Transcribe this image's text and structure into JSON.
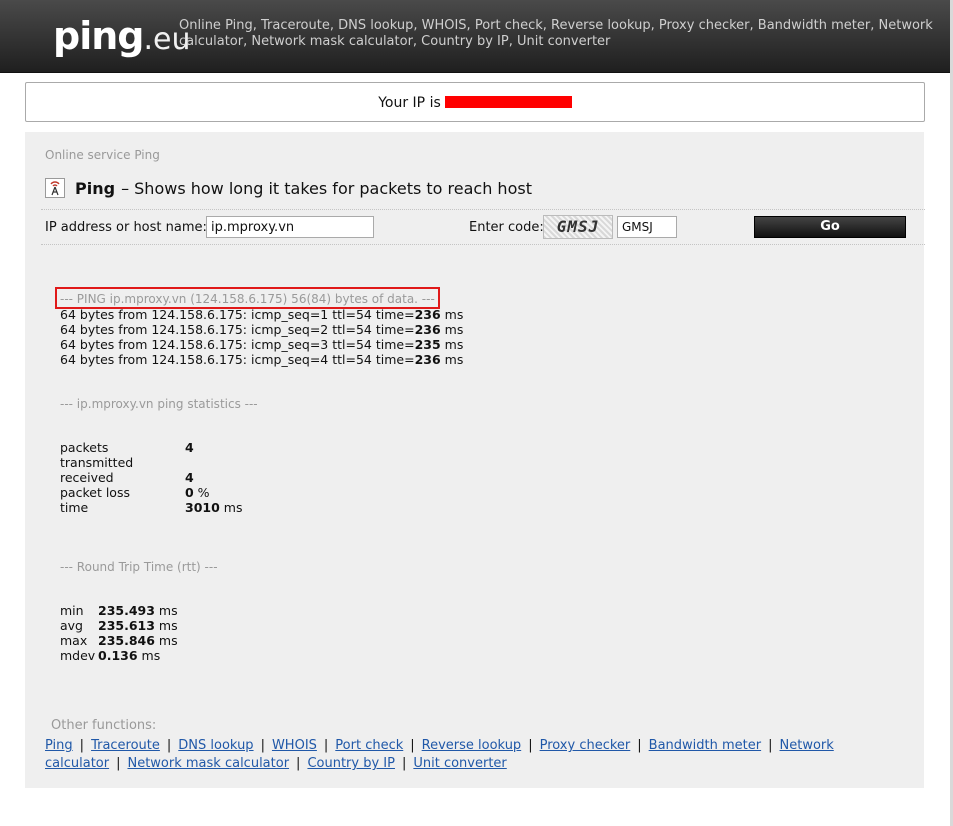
{
  "header": {
    "logo_main": "ping",
    "logo_tld": ".eu",
    "links_text": "Online Ping, Traceroute, DNS lookup, WHOIS, Port check, Reverse lookup, Proxy checker, Bandwidth meter, Network calculator, Network mask calculator, Country by IP, Unit converter"
  },
  "ip_box": {
    "label": "Your IP is"
  },
  "panel": {
    "service_label": "Online service Ping",
    "title_bold": "Ping",
    "title_rest": "– Shows how long it takes for packets to reach host"
  },
  "form": {
    "host_label": "IP address or host name:",
    "host_value": "ip.mproxy.vn",
    "code_label": "Enter code:",
    "captcha_text": "GMSJ",
    "code_value": "GMSJ",
    "go_label": "Go"
  },
  "results": {
    "header_line": "--- PING ip.mproxy.vn (124.158.6.175) 56(84) bytes of data. ---",
    "replies": [
      {
        "prefix": "64 bytes from 124.158.6.175: icmp_seq=1 ttl=54 time=",
        "time": "236",
        "unit": " ms"
      },
      {
        "prefix": "64 bytes from 124.158.6.175: icmp_seq=2 ttl=54 time=",
        "time": "236",
        "unit": " ms"
      },
      {
        "prefix": "64 bytes from 124.158.6.175: icmp_seq=3 ttl=54 time=",
        "time": "235",
        "unit": " ms"
      },
      {
        "prefix": "64 bytes from 124.158.6.175: icmp_seq=4 ttl=54 time=",
        "time": "236",
        "unit": " ms"
      }
    ],
    "stats_header": "--- ip.mproxy.vn ping statistics ---",
    "stats": [
      {
        "label": "packets transmitted",
        "value": "4",
        "unit": ""
      },
      {
        "label": "received",
        "value": "4",
        "unit": ""
      },
      {
        "label": "packet loss",
        "value": "0",
        "unit": " %"
      },
      {
        "label": "time",
        "value": "3010",
        "unit": " ms"
      }
    ],
    "rtt_header": "--- Round Trip Time (rtt) ---",
    "rtt": [
      {
        "label": "min",
        "value": "235.493",
        "unit": " ms"
      },
      {
        "label": "avg",
        "value": "235.613",
        "unit": " ms"
      },
      {
        "label": "max",
        "value": "235.846",
        "unit": " ms"
      },
      {
        "label": "mdev",
        "value": "0.136",
        "unit": " ms"
      }
    ]
  },
  "other": {
    "label": "Other functions:",
    "links": [
      "Ping",
      "Traceroute",
      "DNS lookup",
      "WHOIS",
      "Port check",
      "Reverse lookup",
      "Proxy checker",
      "Bandwidth meter",
      "Network calculator",
      "Network mask calculator",
      "Country by IP",
      "Unit converter"
    ]
  },
  "colors": {
    "header_bg": "#2a2a2a",
    "panel_bg": "#efefef",
    "link": "#2058a8",
    "highlight": "#e01919",
    "redaction": "#ff0000"
  }
}
